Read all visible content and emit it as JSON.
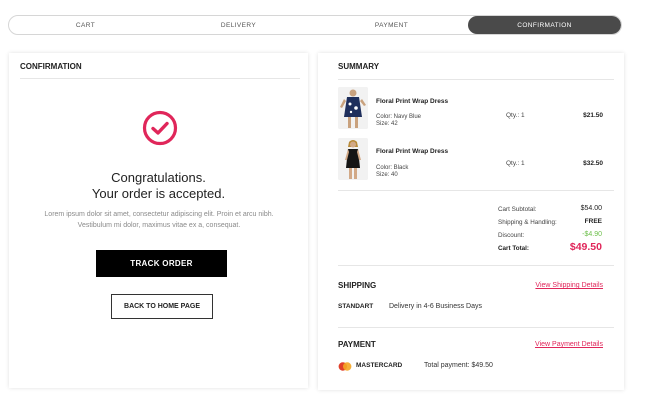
{
  "steps": {
    "cart": "CART",
    "delivery": "DELIVERY",
    "payment": "PAYMENT",
    "confirmation": "CONFIRMATION",
    "active": "confirmation"
  },
  "confirmation": {
    "heading": "CONFIRMATION",
    "congrats_line1": "Congratulations.",
    "congrats_line2": "Your order is accepted.",
    "message": "Lorem ipsum dolor sit amet, consectetur adipiscing elit. Proin et arcu nibh. Vestibulum mi dolor, maximus vitae ex a, consequat.",
    "track_button": "TRACK ORDER",
    "home_button": "BACK TO HOME PAGE"
  },
  "summary": {
    "heading": "SUMMARY",
    "items": [
      {
        "name": "Floral Print Wrap Dress",
        "color": "Color: Navy Blue",
        "size": "Size:  42",
        "qty": "Qty.: 1",
        "price": "$21.50"
      },
      {
        "name": "Floral Print Wrap Dress",
        "color": "Color: Black",
        "size": "Size:  40",
        "qty": "Qty.: 1",
        "price": "$32.50"
      }
    ],
    "totals": {
      "subtotal_label": "Cart Subtotal:",
      "subtotal": "$54.00",
      "shipping_label": "Shipping & Handling:",
      "shipping": "FREE",
      "discount_label": "Discount:",
      "discount": "-$4.90",
      "total_label": "Cart Total:",
      "total": "$49.50"
    }
  },
  "shipping": {
    "heading": "SHIPPING",
    "link": "View Shipping Details",
    "method": "STANDART",
    "description": "Delivery in 4-6 Business Days"
  },
  "payment": {
    "heading": "PAYMENT",
    "link": "View Payment Details",
    "method": "MASTERCARD",
    "description": "Total payment: $49.50"
  },
  "colors": {
    "accent": "#e0265a",
    "discount": "#6cbf4a",
    "active_step": "#4a4a4a",
    "button": "#000000"
  }
}
